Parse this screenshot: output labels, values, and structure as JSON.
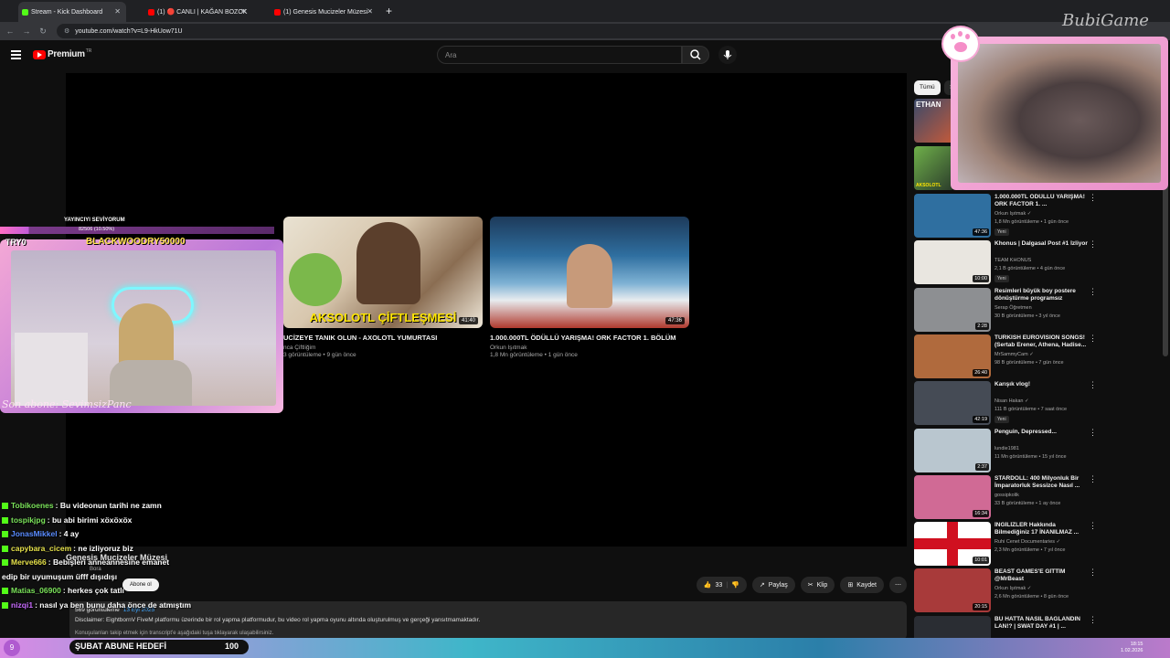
{
  "browser": {
    "tabs": [
      {
        "label": "Stream - Kick Dashboard",
        "color": "#53fc18",
        "active": true
      },
      {
        "label": "(1) 🔴 CANLI | KAĞAN BOZOK",
        "color": "#ff0000",
        "active": false
      },
      {
        "label": "(1) Genesis Mucizeler Müzesi -",
        "color": "#ff0000",
        "active": false
      }
    ],
    "new_tab": "+",
    "url": "youtube.com/watch?v=L9-HkUow71U"
  },
  "youtube": {
    "logo": "Premium",
    "logo_sup": "TR",
    "search_placeholder": "Ara",
    "endscreen": [
      {
        "title": "UCİZEYE TANIK OLUN - AXOLOTL YUMURTASI",
        "channel": "nca Çiftliğim",
        "meta": "3 görüntüleme • 9 gün önce",
        "duration": "41:40",
        "thumb_text": "AKSOLOTL ÇİFTLEŞMESİ"
      },
      {
        "title": "1.000.000TL ÖDÜLLÜ YARIŞMA! ORK FACTOR 1. BÖLÜM",
        "channel": "Orkun Işıtmak",
        "meta": "1,8 Mn görüntüleme • 1 gün önce",
        "duration": "47:36",
        "thumb_text": ""
      }
    ],
    "video": {
      "channel_name": "Genesis Mucizeler Müzesi",
      "channel_sub": "Bora",
      "subscribe_label": "Abone ol",
      "likes": "33",
      "share": "Paylaş",
      "clip": "Klip",
      "save": "Kaydet",
      "views": "569 görüntüleme",
      "date": "13 Eyl 2025",
      "disclaimer": "Disclaimer: EightbornV FiveM platformu üzerinde bir rol yapma platformudur, bu video rol yapma oyunu altında oluşturulmuş ve gerçeği yansıtmamaktadır.",
      "transcript_note": "Konuşulanları takip etmek için transcript'e aşağıdaki tuşa tıklayarak ulaşabilirsiniz."
    },
    "chips": [
      "Tümü",
      "S"
    ],
    "sidebar": [
      {
        "title": "1.000.000TL ÖDÜLLÜ YARIŞMA! ORK FACTOR 1. ...",
        "channel": "Orkun Işıtmak ✓",
        "meta": "1,8 Mn görüntüleme • 1 gün önce",
        "duration": "47:36",
        "badge": "Yeni",
        "thumb_color": "#2f6fa0"
      },
      {
        "title": "Khonus | Dalgasal Post #1 İzliyor",
        "channel": "TEAM KHONUS",
        "meta": "2,1 B görüntüleme • 4 gün önce",
        "duration": "10:00",
        "badge": "Yeni",
        "thumb_color": "#e9e6e0"
      },
      {
        "title": "Resimleri büyük boy postere dönüştürme programsız",
        "channel": "Serap Öğretmen",
        "meta": "30 B görüntüleme • 3 yıl önce",
        "duration": "2:28",
        "badge": "",
        "thumb_color": "#8d8f92"
      },
      {
        "title": "TURKISH EUROVISION SONGS! (Sertab Erener, Athena, Hadise...",
        "channel": "MrSammyCam ✓",
        "meta": "98 B görüntüleme • 7 gün önce",
        "duration": "26:40",
        "badge": "",
        "thumb_color": "#b06a3d"
      },
      {
        "title": "Karışık vlog!",
        "channel": "Nisan Hakan ✓",
        "meta": "111 B görüntüleme • 7 saat önce",
        "duration": "42:19",
        "badge": "Yeni",
        "thumb_color": "#454b55"
      },
      {
        "title": "Penguin, Depressed...",
        "channel": "lundie1981",
        "meta": "11 Mn görüntüleme • 15 yıl önce",
        "duration": "2:37",
        "badge": "",
        "thumb_color": "#b9c6cf"
      },
      {
        "title": "STARDOLL: 400 Milyonluk Bir İmparatorluk Sessizce Nasıl ...",
        "channel": "gossipkolik",
        "meta": "33 B görüntüleme • 1 ay önce",
        "duration": "16:34",
        "badge": "",
        "thumb_color": "#d06a95"
      },
      {
        "title": "İNGİLİZLER Hakkında Bilmediğiniz 17 İNANILMAZ ...",
        "channel": "Ruhi Cenet Documentaries ✓",
        "meta": "2,3 Mn görüntüleme • 7 yıl önce",
        "duration": "10:01",
        "badge": "",
        "thumb_color": "#ffffff"
      },
      {
        "title": "BEAST GAMES'E GİTTİM @MrBeast",
        "channel": "Orkun Işıtmak ✓",
        "meta": "2,6 Mn görüntüleme • 8 gün önce",
        "duration": "20:15",
        "badge": "",
        "thumb_color": "#a83a3a"
      },
      {
        "title": "BU HATTA NASIL BAĞLANDIN LAN!? | SWAT DAY #1 | ...",
        "channel": "",
        "meta": "",
        "duration": "",
        "badge": "",
        "thumb_color": "#2a2d33"
      }
    ],
    "sidebar_thumb_top": [
      "ETHAN",
      "AKSOLOTL"
    ]
  },
  "stream_overlay": {
    "top_label": "YAYINCIYI SEVİYORUM",
    "progress_text": "82506 (10.50%)",
    "progress": 0.105,
    "name_text": "BLACKWOODRY50000",
    "try_text": "TRY0",
    "last_sub": "Son abone: SevimsizPanc",
    "brand": "BubiGame"
  },
  "chat": [
    {
      "user": "Tobikoenes",
      "user_color": "#7be35a",
      "msg": "Bu videonun tarihi ne zamn"
    },
    {
      "user": "tospikjpg",
      "user_color": "#7be35a",
      "msg": "bu abi birimi xöxöxöx"
    },
    {
      "user": "JonasMikkel",
      "user_color": "#5a8cff",
      "msg": "4 ay"
    },
    {
      "user": "capybara_cicem",
      "user_color": "#e4e04a",
      "msg": "ne izliyoruz biz"
    },
    {
      "user": "Merve666",
      "user_color": "#e4e04a",
      "msg": "Bebişleri anneannesine emanet edip bir uyumuşum üfff dışıdışı"
    },
    {
      "user": "Matias_06900",
      "user_color": "#7be35a",
      "msg": "herkes çok tatlı"
    },
    {
      "user": "nizqi1",
      "user_color": "#c96bff",
      "msg": "nasıl ya ben bunu daha önce de atmıştım"
    }
  ],
  "goal": {
    "label": "ŞUBAT ABUNE HEDEFİ",
    "value": "100",
    "circle": "9"
  },
  "clock": {
    "time": "18:15",
    "date": "1.02.2026"
  }
}
